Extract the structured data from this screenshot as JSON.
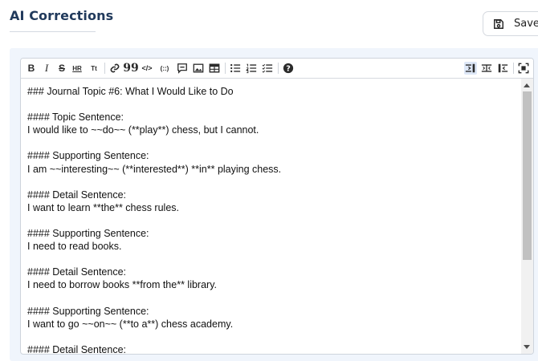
{
  "header": {
    "title": "AI Corrections",
    "save_label": "Save"
  },
  "toolbar": {
    "bold": "B",
    "italic": "I",
    "strikethrough": "S",
    "hr": "HR",
    "title": "Tt",
    "quote": "99",
    "code": "</>",
    "code_block": "(::)",
    "help": "?"
  },
  "editor": {
    "lines": [
      "### Journal Topic #6: What I Would Like to Do",
      "",
      "#### Topic Sentence:",
      "I would like to ~~do~~ (**play**) chess, but I cannot.",
      "",
      "#### Supporting Sentence:",
      "I am ~~interesting~~ (**interested**) **in** playing chess.",
      "",
      "#### Detail Sentence:",
      "I want to learn **the** chess rules.",
      "",
      "#### Supporting Sentence:",
      "I need to read books.",
      "",
      "#### Detail Sentence:",
      "I need to borrow books **from the** library.",
      "",
      "#### Supporting Sentence:",
      "I want to go ~~on~~ (**to a**) chess academy.",
      "",
      "#### Detail Sentence:"
    ]
  },
  "colors": {
    "title": "#213a5c",
    "panel_bg": "#f0f5fc",
    "active_tool_bg": "#dde7f7"
  }
}
